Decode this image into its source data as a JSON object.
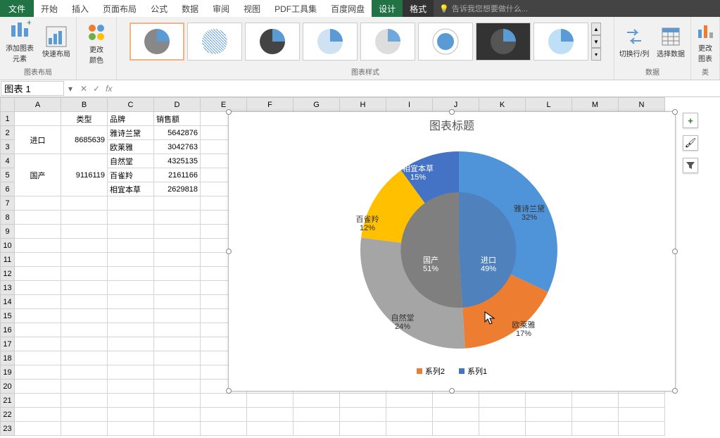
{
  "ribbon": {
    "tabs": [
      "文件",
      "开始",
      "插入",
      "页面布局",
      "公式",
      "数据",
      "审阅",
      "视图",
      "PDF工具集",
      "百度网盘",
      "设计",
      "格式"
    ],
    "active_tab": "设计",
    "dark_tab": "格式",
    "tellme": "告诉我您想要做什么...",
    "groups": {
      "layout": {
        "add_chart_el": "添加图表\n元素",
        "quick_layout": "快速布局",
        "label": "图表布局"
      },
      "colors": {
        "change_colors": "更改\n颜色"
      },
      "styles": {
        "label": "图表样式"
      },
      "data": {
        "switch": "切换行/列",
        "select": "选择数据",
        "label": "数据"
      },
      "type": {
        "change_type": "更改\n图表",
        "label": "类"
      }
    }
  },
  "namebox": {
    "value": "图表 1"
  },
  "columns": [
    "A",
    "B",
    "C",
    "D",
    "E",
    "F",
    "G",
    "H",
    "I",
    "J",
    "K",
    "L",
    "M",
    "N"
  ],
  "rows_shown": 23,
  "sheet": {
    "headers": {
      "type": "类型",
      "brand": "品牌",
      "sales": "销售额"
    },
    "rows": [
      {
        "type": "进口",
        "type_sum": "8685639",
        "brand": "雅诗兰黛",
        "sales": "5642876"
      },
      {
        "type": "",
        "type_sum": "",
        "brand": "欧莱雅",
        "sales": "3042763"
      },
      {
        "type": "国产",
        "type_sum": "9116119",
        "brand": "自然堂",
        "sales": "4325135"
      },
      {
        "type": "",
        "type_sum": "",
        "brand": "百雀羚",
        "sales": "2161166"
      },
      {
        "type": "",
        "type_sum": "",
        "brand": "相宜本草",
        "sales": "2629818"
      }
    ]
  },
  "chart": {
    "title": "图表标题",
    "legend": {
      "s2": "系列2",
      "s1": "系列1"
    },
    "labels": {
      "import": {
        "name": "进口",
        "pct": "49%"
      },
      "domestic": {
        "name": "国产",
        "pct": "51%"
      },
      "ysld": {
        "name": "雅诗兰黛",
        "pct": "32%"
      },
      "oly": {
        "name": "欧莱雅",
        "pct": "17%"
      },
      "zrt": {
        "name": "自然堂",
        "pct": "24%"
      },
      "bql": {
        "name": "百雀羚",
        "pct": "12%"
      },
      "xybc": {
        "name": "相宜本草",
        "pct": "15%"
      }
    }
  },
  "chart_data": {
    "type": "pie",
    "title": "图表标题",
    "series": [
      {
        "name": "系列2",
        "ring": "inner",
        "categories": [
          "进口",
          "国产"
        ],
        "values": [
          8685639,
          9116119
        ],
        "percent": [
          49,
          51
        ]
      },
      {
        "name": "系列1",
        "ring": "outer",
        "categories": [
          "雅诗兰黛",
          "欧莱雅",
          "自然堂",
          "百雀羚",
          "相宜本草"
        ],
        "values": [
          5642876,
          3042763,
          4325135,
          2161166,
          2629818
        ],
        "percent": [
          32,
          17,
          24,
          12,
          15
        ]
      }
    ],
    "colors": {
      "进口": "#4472C4",
      "国产": "#7F7F7F",
      "雅诗兰黛": "#4F93D9",
      "欧莱雅": "#ED7D31",
      "自然堂": "#A5A5A5",
      "百雀羚": "#FFC000",
      "相宜本草": "#5B9BD5"
    }
  },
  "sidebtns": {
    "plus": "+",
    "brush": "🖌",
    "filter": "▼"
  }
}
